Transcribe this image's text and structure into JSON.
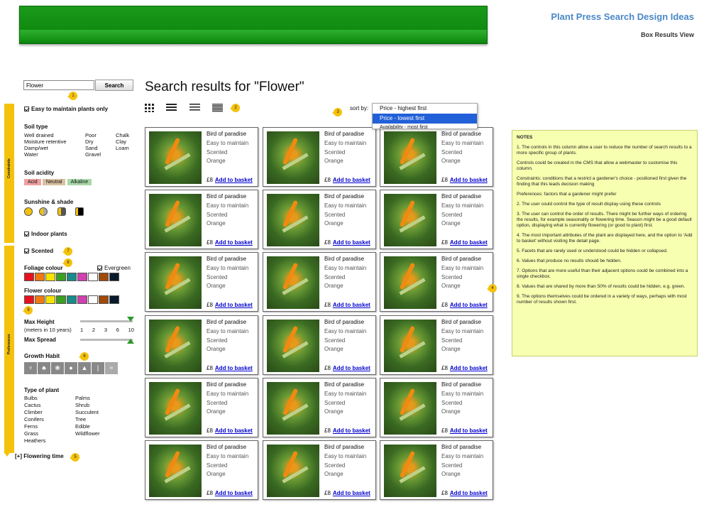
{
  "doc": {
    "title": "Plant Press Search Design Ideas",
    "subtitle": "Box Results View"
  },
  "search": {
    "value": "Flower",
    "button": "Search"
  },
  "filters": {
    "easy": "Easy to maintain plants only",
    "soil_type": {
      "label": "Soil type",
      "col1": [
        "Well drained",
        "Moisture retentive",
        "Damp/wet",
        "Water"
      ],
      "col2": [
        "Poor",
        "Dry",
        "Sand",
        "Gravel"
      ],
      "col3": [
        "Chalk",
        "Clay",
        "Loam"
      ]
    },
    "soil_acidity": {
      "label": "Soil acidity",
      "acid": "Acid",
      "neutral": "Neutral",
      "alkaline": "Alkaline"
    },
    "sunshine": "Sunshine & shade",
    "indoor": "Indoor plants",
    "scented": "Scented",
    "foliage": "Foliage colour",
    "evergreen": "Evergreen",
    "flower": "Flower colour",
    "max_height": "Max Height",
    "height_unit": "(meters in 10 years)",
    "height_ticks": [
      "1",
      "2",
      "3",
      "6",
      "10"
    ],
    "max_spread": "Max Spread",
    "growth": "Growth Habit",
    "type_label": "Type of plant",
    "types1": [
      "Bulbs",
      "Cactus",
      "Climber",
      "Conifers",
      "Ferns",
      "Grass",
      "Heathers"
    ],
    "types2": [
      "Palms",
      "Shrub",
      "Succulent",
      "Tree",
      "Edible",
      "Wildflower"
    ],
    "flowering": "[+] Flowering time",
    "constraints": "Constraints",
    "preferences": "Preferences"
  },
  "colours": [
    "#e8101c",
    "#f07a10",
    "#f5e400",
    "#3aa020",
    "#1a8a8a",
    "#d040b0",
    "#ffffff",
    "#a04a0a",
    "#0a1a2a"
  ],
  "results": {
    "heading": "Search results for \"Flower\"",
    "sort_label": "sort by:",
    "sort_options": [
      "Price - highest first",
      "Price - lowest first",
      "Availability - most first"
    ]
  },
  "card": {
    "name": "Bird of paradise",
    "a1": "Easy to maintain",
    "a2": "Scented",
    "a3": "Orange",
    "price": "£8",
    "basket": "Add to basket"
  },
  "badges": [
    "1",
    "2",
    "3",
    "4",
    "5",
    "6",
    "7",
    "8",
    "9"
  ],
  "notes": {
    "title": "NOTES",
    "items": [
      "1. The controls in this column allow a user to reduce the number of search results to a more specific group of plants.",
      "Controls could be created in the CMS that allow a webmaster to customise this column.",
      "Constraints: conditions that a restrict a gardener's choice - positioned first given the finding that this leads decision making",
      "Preferences: factors that a gardener might prefer",
      "2. The user could control the type of result display using these controls",
      "3. The user can control the order of results. There might be further ways of ordering the results, for example seasonality or flowering time. Season might be a good default option, displaying what is currently flowering (or good to plant) first.",
      "4. The most important attributes of the plant are displayed here, and the option to 'Add to basket' without visiting the detail page.",
      "5. Facets that are rarely used or understood could be hidden or collapsed.",
      "6. Values that produce no results should be hidden.",
      "7. Options that are more useful than their adjacent options could be combined into a single checkbox.",
      "8. Values that are shared by more than 50% of results could be hidden, e.g. green.",
      "9. The options themselves could be ordered in a variety of ways, perhaps with most number of results shown first."
    ]
  }
}
